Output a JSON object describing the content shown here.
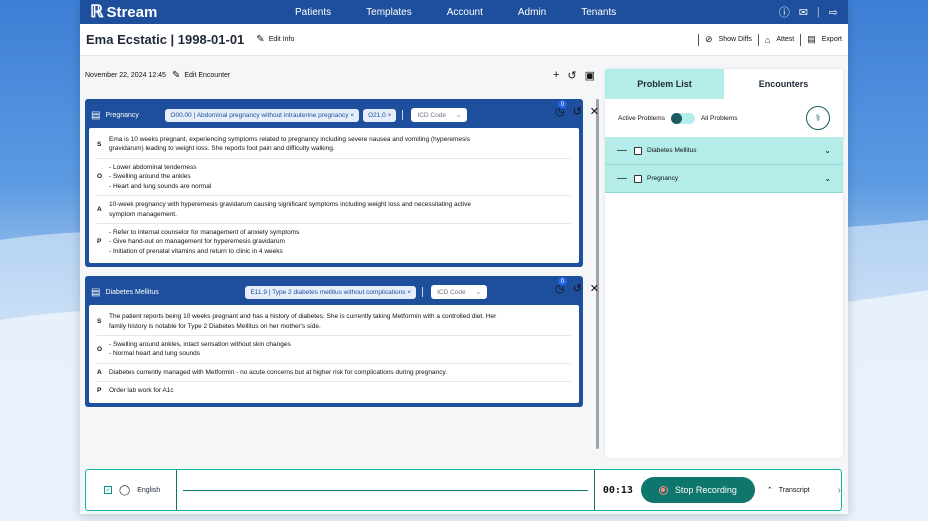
{
  "nav": {
    "brand": "Stream",
    "links": [
      "Patients",
      "Templates",
      "Account",
      "Admin",
      "Tenants"
    ]
  },
  "header": {
    "patient_title": "Ema Ecstatic | 1998-01-01",
    "edit_info": "Edit Info",
    "show_diffs": "Show Diffs",
    "attest": "Attest",
    "export": "Export"
  },
  "encounter": {
    "datetime": "November 22, 2024 12:45",
    "edit_label": "Edit Encounter"
  },
  "cards": [
    {
      "title": "Pregnancy",
      "codes": [
        "O00.00 | Abdominal pregnancy without intrauterine pregnancy ×",
        "O21.0 ×"
      ],
      "icd_placeholder": "ICD Code",
      "badge": "0",
      "soap": [
        {
          "label": "S",
          "lines": [
            "Ema is 10 weeks pregnant, experiencing symptoms related to pregnancy including severe nausea and vomiting (hyperemesis",
            "gravidarum) leading to weight loss. She reports foot pain and difficulty walking."
          ]
        },
        {
          "label": "O",
          "lines": [
            "- Lower abdominal tenderness",
            "- Swelling around the ankles",
            "- Heart and lung sounds are normal"
          ]
        },
        {
          "label": "A",
          "lines": [
            "10-week pregnancy with hyperemesis gravidarum causing significant symptoms including weight loss and necessitating active",
            "symptom management."
          ]
        },
        {
          "label": "P",
          "lines": [
            "- Refer to internal counselor for management of anxiety symptoms",
            "- Give hand-out on management for hyperemesis gravidarum",
            "- Initiation of prenatal vitamins and return to clinic in 4 weeks"
          ]
        }
      ]
    },
    {
      "title": "Diabetes Mellitus",
      "codes": [
        "E11.9 | Type 2 diabetes mellitus without complications ×"
      ],
      "icd_placeholder": "ICD Code",
      "badge": "0",
      "soap": [
        {
          "label": "S",
          "lines": [
            "The patient reports being 10 weeks pregnant and has a history of diabetes. She is currently taking Metformin with a controlled diet. Her",
            "family history is notable for Type 2 Diabetes Mellitus on her mother's side."
          ]
        },
        {
          "label": "O",
          "lines": [
            "- Swelling around ankles, intact sensation without skin changes",
            "- Normal heart and lung sounds"
          ]
        },
        {
          "label": "A",
          "lines": [
            "Diabetes currently managed with Metformin - no acute concerns but at higher risk for complications during pregnancy."
          ]
        },
        {
          "label": "P",
          "lines": [
            "Order lab work for A1c"
          ]
        }
      ]
    }
  ],
  "sidebar": {
    "tabs": [
      "Problem List",
      "Encounters"
    ],
    "active_label": "Active Problems",
    "all_label": "All Problems",
    "problems": [
      "Diabetes Mellitus",
      "Pregnancy"
    ]
  },
  "recorder": {
    "language": "English",
    "timer": "00:13",
    "stop_label": "Stop Recording",
    "transcript_label": "Transcript"
  }
}
